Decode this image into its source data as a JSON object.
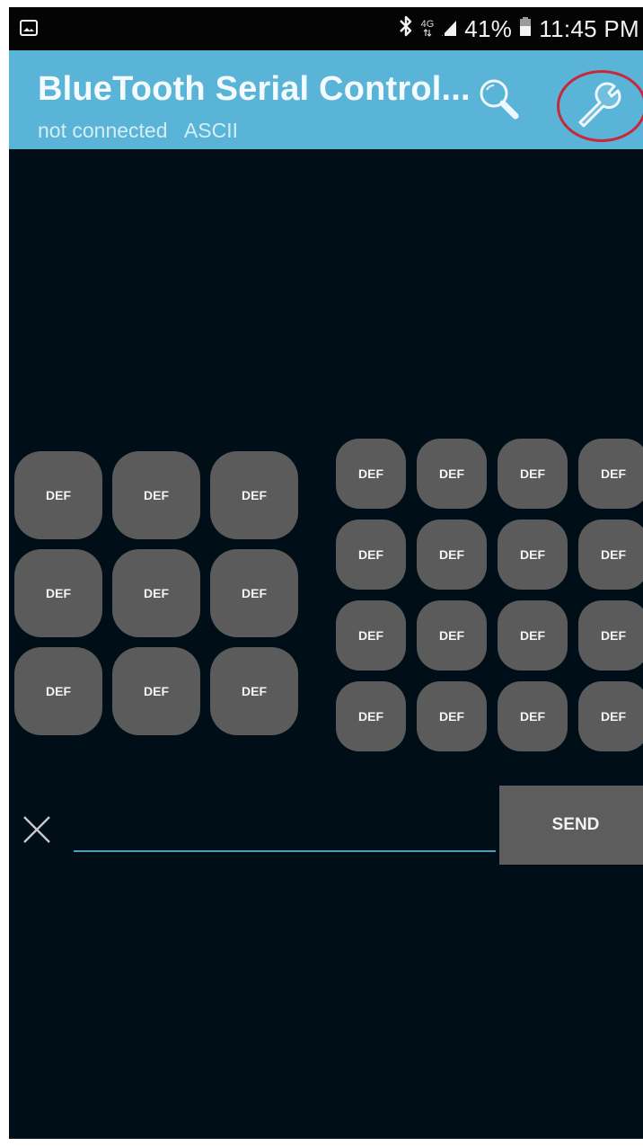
{
  "status_bar": {
    "network_type": "4G",
    "battery_percent": "41%",
    "time": "11:45 PM"
  },
  "app_bar": {
    "title": "BlueTooth Serial Control...",
    "connection_status": "not connected",
    "mode": "ASCII",
    "search_icon": "search-icon",
    "settings_icon": "wrench-icon",
    "highlight_color": "#c8283a"
  },
  "left_pad": {
    "rows": [
      [
        "DEF",
        "DEF",
        "DEF"
      ],
      [
        "DEF",
        "DEF",
        "DEF"
      ],
      [
        "DEF",
        "DEF",
        "DEF"
      ]
    ]
  },
  "right_pad": {
    "rows": [
      [
        "DEF",
        "DEF",
        "DEF",
        "DEF"
      ],
      [
        "DEF",
        "DEF",
        "DEF",
        "DEF"
      ],
      [
        "DEF",
        "DEF",
        "DEF",
        "DEF"
      ],
      [
        "DEF",
        "DEF",
        "DEF",
        "DEF"
      ]
    ]
  },
  "input_row": {
    "message_value": "",
    "send_label": "SEND",
    "clear_icon": "close-icon"
  },
  "colors": {
    "app_bar": "#59b4d8",
    "background": "#000f17",
    "button": "#5b5b5b",
    "input_underline": "#4c9fc3"
  }
}
